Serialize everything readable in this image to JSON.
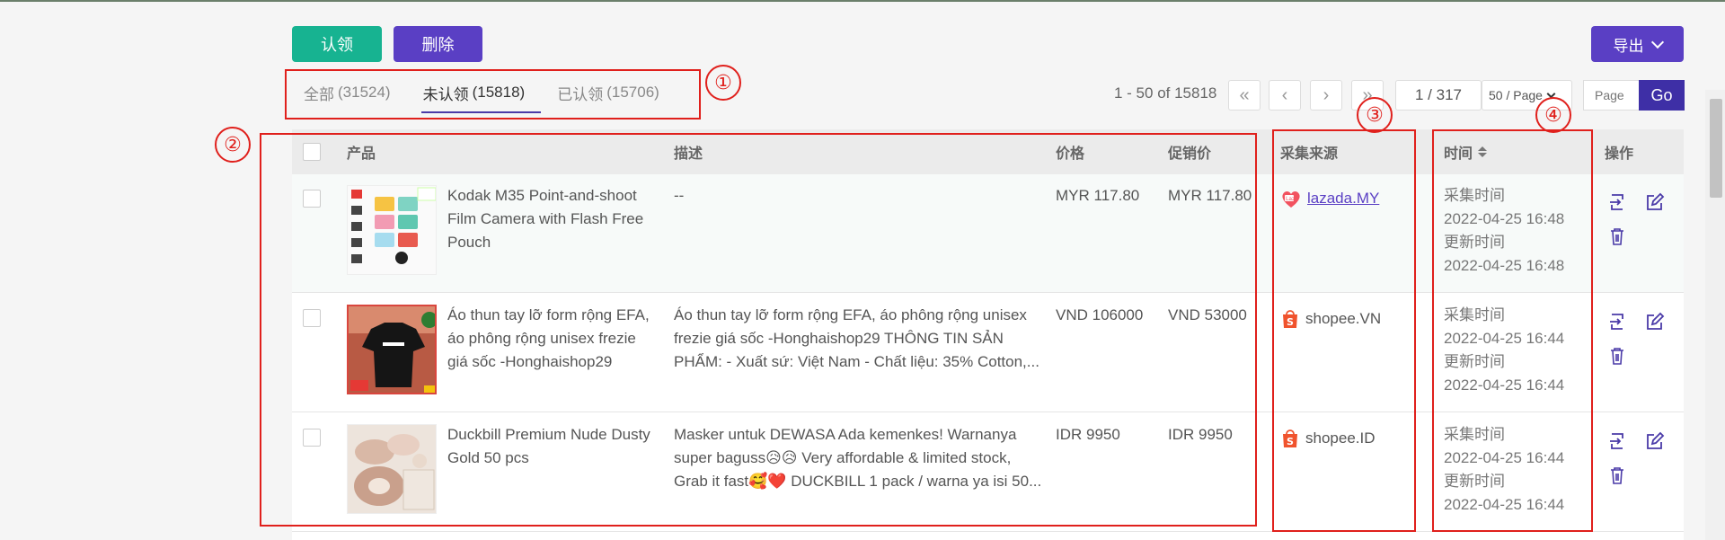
{
  "toolbar": {
    "claim_label": "认领",
    "delete_label": "删除",
    "export_label": "导出"
  },
  "tabs": [
    {
      "label": "全部",
      "count": "(31524)"
    },
    {
      "label": "未认领",
      "count": "(15818)"
    },
    {
      "label": "已认领",
      "count": "(15706)"
    }
  ],
  "pagination": {
    "info": "1 - 50 of 15818",
    "first": "«",
    "prev": "‹",
    "next": "›",
    "last": "»",
    "page_display": "1 / 317",
    "per_page": "50 / Page",
    "page_input_placeholder": "Page",
    "go_label": "Go"
  },
  "table": {
    "headers": {
      "product": "产品",
      "description": "描述",
      "price": "价格",
      "promo": "促销价",
      "source": "采集来源",
      "time": "时间",
      "action": "操作"
    },
    "rows": [
      {
        "name": "Kodak M35 Point-and-shoot Film Camera with Flash Free Pouch",
        "description_l1": "--",
        "description_l2": "",
        "description_l3": "",
        "price": "MYR 117.80",
        "promo": "MYR 117.80",
        "source": "lazada.MY",
        "source_icon": "lazada-icon",
        "collect_label": "采集时间",
        "collect_time": "2022-04-25 16:48",
        "update_label": "更新时间",
        "update_time": "2022-04-25 16:48"
      },
      {
        "name": "Áo thun tay lỡ form rộng EFA, áo phông rộng unisex frezie giá sốc -Honghaishop29",
        "description_l1": "Áo thun tay lỡ form rộng EFA, áo phông rộng unisex",
        "description_l2": "frezie giá sốc -Honghaishop29 THÔNG TIN SẢN",
        "description_l3": "PHẨM: - Xuất sứ: Việt Nam - Chất liệu: 35% Cotton,...",
        "price": "VND 106000",
        "promo": "VND 53000",
        "source": "shopee.VN",
        "source_icon": "shopee-icon",
        "collect_label": "采集时间",
        "collect_time": "2022-04-25 16:44",
        "update_label": "更新时间",
        "update_time": "2022-04-25 16:44"
      },
      {
        "name": "Duckbill Premium Nude Dusty Gold 50 pcs",
        "description_l1": "Masker untuk DEWASA Ada kemenkes! Warnanya",
        "description_l2": "super baguss😥😥 Very affordable & limited stock,",
        "description_l3": "Grab it fast🥰❤️ DUCKBILL 1 pack / warna ya isi 50...",
        "price": "IDR 9950",
        "promo": "IDR 9950",
        "source": "shopee.ID",
        "source_icon": "shopee-icon",
        "collect_label": "采集时间",
        "collect_time": "2022-04-25 16:44",
        "update_label": "更新时间",
        "update_time": "2022-04-25 16:44"
      }
    ]
  },
  "annotations": [
    "①",
    "②",
    "③",
    "④"
  ],
  "colors": {
    "claim": "#17b391",
    "primary": "#5a3fc4",
    "annotation": "#e0201c"
  }
}
